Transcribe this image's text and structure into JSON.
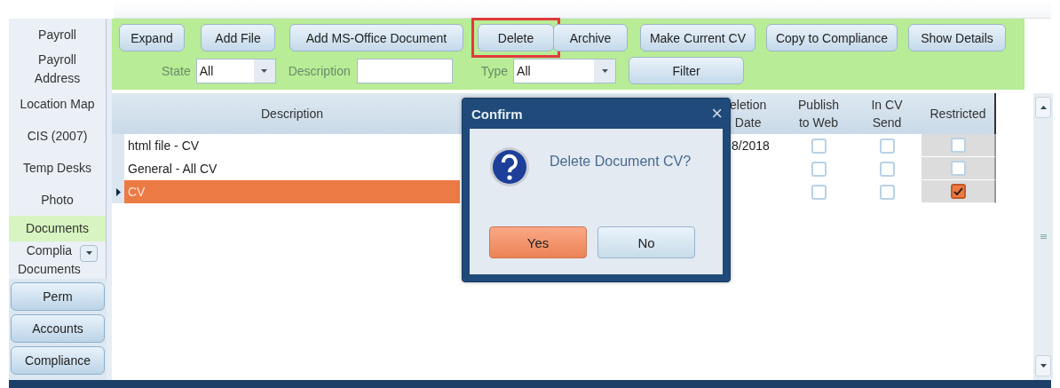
{
  "sidebar": {
    "items": [
      {
        "label": "Payroll",
        "selected": false
      },
      {
        "label": "Payroll\nAddress",
        "selected": false
      },
      {
        "label": "Location Map",
        "selected": false
      },
      {
        "label": "CIS (2007)",
        "selected": false
      },
      {
        "label": "Temp Desks",
        "selected": false
      },
      {
        "label": "Photo",
        "selected": false
      },
      {
        "label": "Documents",
        "selected": true
      },
      {
        "label": "Complia\nDocuments",
        "selected": false,
        "dropdown": true
      }
    ],
    "buttons": [
      "Perm",
      "Accounts",
      "Compliance"
    ]
  },
  "toolbar": {
    "buttons": [
      {
        "label": "Expand",
        "highlighted": false
      },
      {
        "label": "Add File",
        "highlighted": false
      },
      {
        "label": "Add MS-Office Document",
        "highlighted": false
      },
      {
        "label": "Delete",
        "highlighted": true
      },
      {
        "label": "Archive",
        "highlighted": false
      },
      {
        "label": "Make Current CV",
        "highlighted": false
      },
      {
        "label": "Copy to Compliance",
        "highlighted": false
      },
      {
        "label": "Show Details",
        "highlighted": false
      }
    ],
    "filters": {
      "state_label": "State",
      "state_value": "All",
      "description_label": "Description",
      "type_label": "Type",
      "type_value": "All",
      "filter_button": "Filter"
    }
  },
  "table": {
    "columns": [
      "Description",
      "eletion\nDate",
      "Publish\nto Web",
      "In CV\nSend",
      "Restricted"
    ],
    "rows": [
      {
        "description": "html file - CV",
        "deletion_date": "8/2018",
        "publish": false,
        "in_cv": false,
        "restricted": false,
        "selected": false
      },
      {
        "description": "General - All CV",
        "publish": false,
        "in_cv": false,
        "restricted": false,
        "selected": false
      },
      {
        "description": "CV",
        "publish": false,
        "in_cv": false,
        "restricted": true,
        "selected": true
      }
    ]
  },
  "dialog": {
    "title": "Confirm",
    "close": "×",
    "message": "Delete Document CV?",
    "buttons": [
      {
        "label": "Yes",
        "default": true
      },
      {
        "label": "No",
        "default": false
      }
    ]
  }
}
